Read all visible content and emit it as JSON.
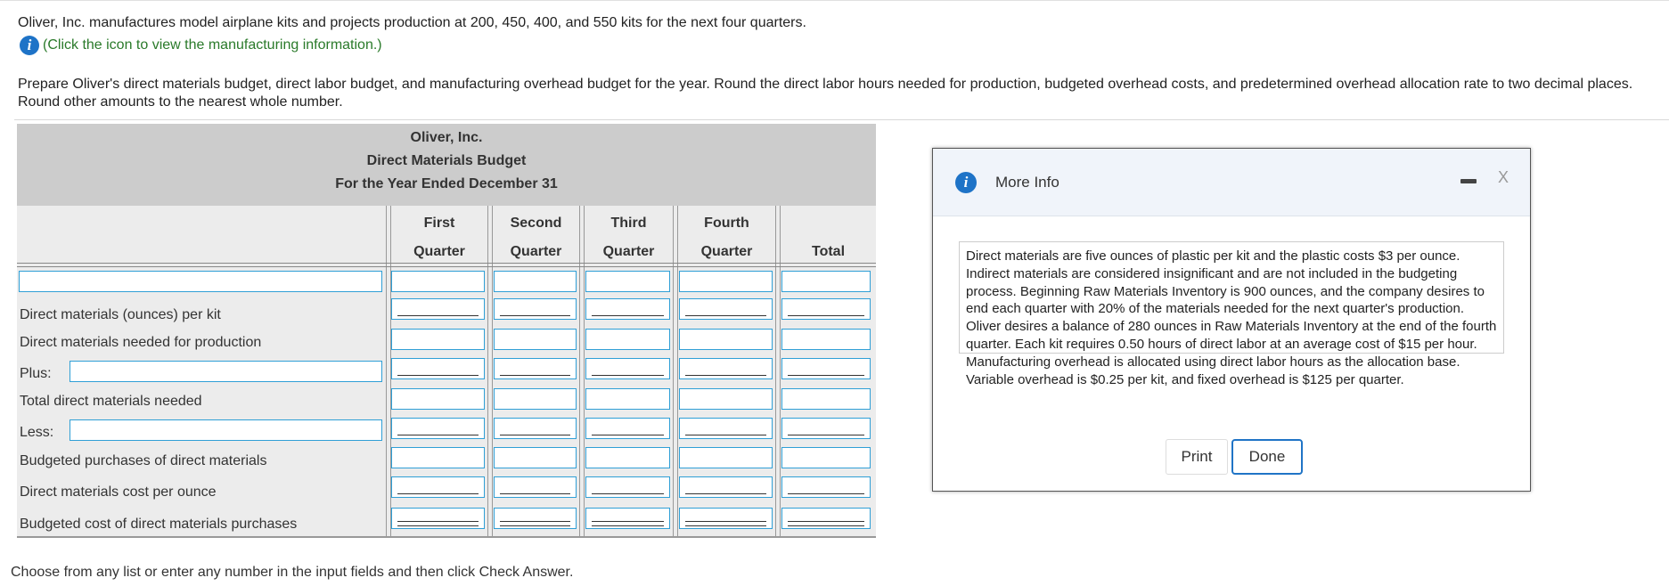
{
  "problem": {
    "line1": "Oliver, Inc. manufactures model airplane kits and projects production at 200, 450, 400, and 550 kits for the next four quarters.",
    "info_link": "(Click the icon to view the manufacturing information.)",
    "instructions": "Prepare Oliver's direct materials budget, direct labor budget, and manufacturing overhead budget for the year. Round the direct labor hours needed for production, budgeted overhead costs, and predetermined overhead allocation rate to two decimal places. Round other amounts to the nearest whole number."
  },
  "table": {
    "company": "Oliver, Inc.",
    "title": "Direct Materials Budget",
    "period": "For the Year Ended December 31",
    "columns": [
      {
        "top": "First",
        "bottom": "Quarter"
      },
      {
        "top": "Second",
        "bottom": "Quarter"
      },
      {
        "top": "Third",
        "bottom": "Quarter"
      },
      {
        "top": "Fourth",
        "bottom": "Quarter"
      },
      {
        "top": "",
        "bottom": "Total"
      }
    ],
    "rows": {
      "r2": "Direct materials (ounces) per kit",
      "r3": "Direct materials needed for production",
      "r4": "Plus:",
      "r5": "Total direct materials needed",
      "r6": "Less:",
      "r7": "Budgeted purchases of direct materials",
      "r8": "Direct materials cost per ounce",
      "r9": "Budgeted cost of direct materials purchases"
    }
  },
  "footer": "Choose from any list or enter any number in the input fields and then click Check Answer.",
  "modal": {
    "title": "More Info",
    "close": "X",
    "text": "Direct materials are five ounces of plastic per kit and the plastic costs $3 per ounce. Indirect materials are considered insignificant and are not included in the budgeting process. Beginning Raw Materials Inventory is 900 ounces, and the company desires to end each quarter with 20% of the materials needed for the next quarter's production. Oliver desires a balance of 280 ounces in Raw Materials Inventory at the end of the fourth quarter. Each kit requires 0.50 hours of direct labor at an average cost of $15 per hour. Manufacturing overhead is allocated using direct labor hours as the allocation base. Variable overhead is $0.25 per kit, and fixed overhead is $125 per quarter.",
    "print_label": "Print",
    "done_label": "Done"
  },
  "icons": {
    "info": "info-icon",
    "minimize": "minimize-icon"
  },
  "colors": {
    "accent": "#1e73c7",
    "input_border": "#2f9fd6",
    "link_green": "#2a7a2a",
    "header_gray": "#cccccc",
    "body_gray": "#ececec"
  }
}
